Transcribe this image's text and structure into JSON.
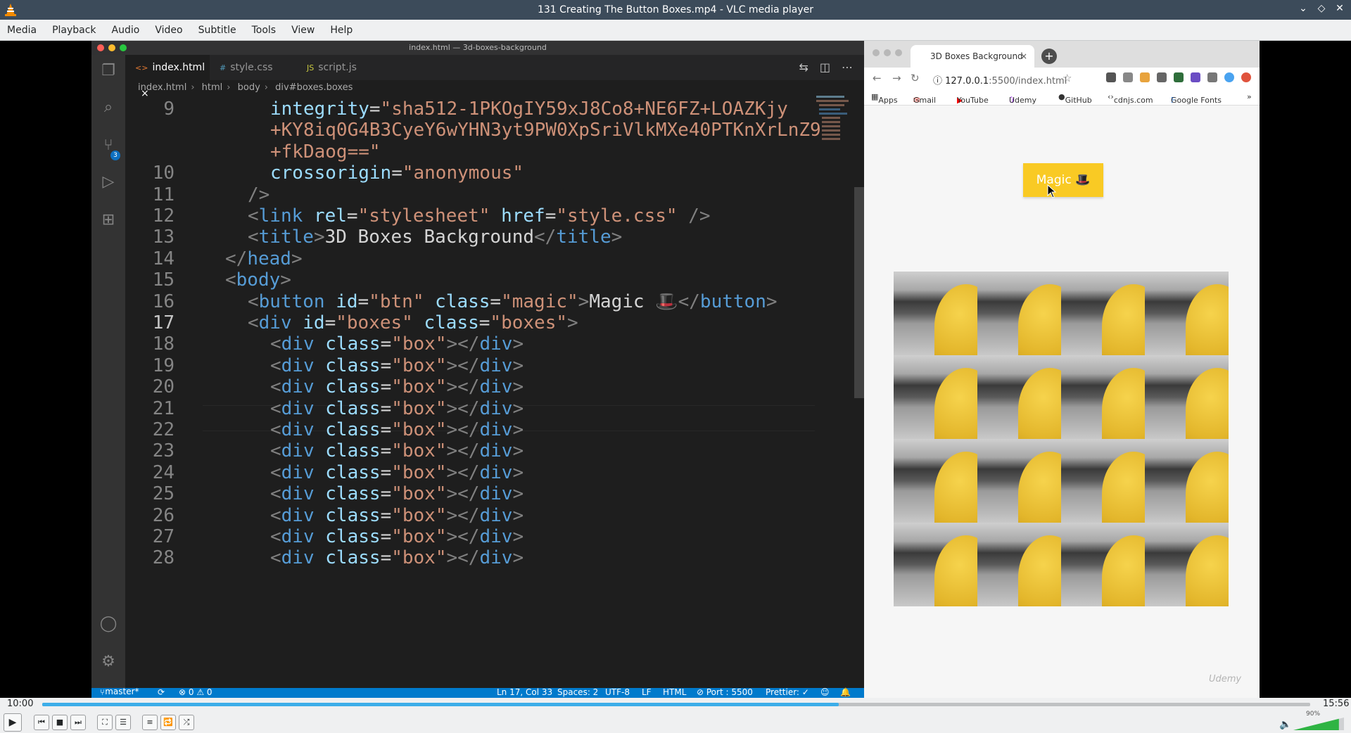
{
  "window": {
    "title": "131 Creating The Button Boxes.mp4 - VLC media player",
    "controls": [
      "⌄",
      "◇",
      "✕"
    ]
  },
  "menu": [
    "Media",
    "Playback",
    "Audio",
    "Video",
    "Subtitle",
    "Tools",
    "View",
    "Help"
  ],
  "editor": {
    "window_title": "index.html — 3d-boxes-background",
    "tabs": [
      {
        "icon": "<>",
        "label": "index.html",
        "close": "×"
      },
      {
        "icon": "#",
        "label": "style.css"
      },
      {
        "icon": "JS",
        "label": "script.js"
      }
    ],
    "breadcrumb": [
      "index.html",
      "html",
      "body",
      "div#boxes.boxes"
    ],
    "scm_badge": "3",
    "lines": [
      {
        "n": "9",
        "parts": [
          [
            "t-attr",
            "integrity"
          ],
          [
            "t-txt",
            "="
          ],
          [
            "t-str",
            "\"sha512-1PKOgIY59xJ8Co8+NE6FZ+LOAZKjy"
          ]
        ]
      },
      {
        "n": "",
        "parts": [
          [
            "t-str",
            "+KY8iq0G4B3CyeY6wYHN3yt9PW0XpSriVlkMXe40PTKnXrLnZ9"
          ]
        ]
      },
      {
        "n": "",
        "parts": [
          [
            "t-str",
            "+fkDaog==\""
          ]
        ]
      },
      {
        "n": "10",
        "parts": [
          [
            "t-attr",
            "crossorigin"
          ],
          [
            "t-txt",
            "="
          ],
          [
            "t-str",
            "\"anonymous\""
          ]
        ]
      },
      {
        "n": "11",
        "parts": [
          [
            "t-brk",
            "/>"
          ]
        ]
      },
      {
        "n": "12",
        "parts": [
          [
            "t-brk",
            "<"
          ],
          [
            "t-tag",
            "link"
          ],
          [
            "t-txt",
            " "
          ],
          [
            "t-attr",
            "rel"
          ],
          [
            "t-txt",
            "="
          ],
          [
            "t-str",
            "\"stylesheet\""
          ],
          [
            "t-txt",
            " "
          ],
          [
            "t-attr",
            "href"
          ],
          [
            "t-txt",
            "="
          ],
          [
            "t-str",
            "\"style.css\""
          ],
          [
            "t-txt",
            " "
          ],
          [
            "t-brk",
            "/>"
          ]
        ]
      },
      {
        "n": "13",
        "parts": [
          [
            "t-brk",
            "<"
          ],
          [
            "t-tag",
            "title"
          ],
          [
            "t-brk",
            ">"
          ],
          [
            "t-txt",
            "3D Boxes Background"
          ],
          [
            "t-brk",
            "</"
          ],
          [
            "t-tag",
            "title"
          ],
          [
            "t-brk",
            ">"
          ]
        ]
      },
      {
        "n": "14",
        "parts": [
          [
            "t-brk",
            "</"
          ],
          [
            "t-tag",
            "head"
          ],
          [
            "t-brk",
            ">"
          ]
        ]
      },
      {
        "n": "15",
        "parts": [
          [
            "t-brk",
            "<"
          ],
          [
            "t-tag",
            "body"
          ],
          [
            "t-brk",
            ">"
          ]
        ]
      },
      {
        "n": "16",
        "parts": [
          [
            "t-brk",
            "<"
          ],
          [
            "t-tag",
            "button"
          ],
          [
            "t-txt",
            " "
          ],
          [
            "t-attr",
            "id"
          ],
          [
            "t-txt",
            "="
          ],
          [
            "t-str",
            "\"btn\""
          ],
          [
            "t-txt",
            " "
          ],
          [
            "t-attr",
            "class"
          ],
          [
            "t-txt",
            "="
          ],
          [
            "t-str",
            "\"magic\""
          ],
          [
            "t-brk",
            ">"
          ],
          [
            "t-txt",
            "Magic 🎩"
          ],
          [
            "t-brk",
            "</"
          ],
          [
            "t-tag",
            "button"
          ],
          [
            "t-brk",
            ">"
          ]
        ]
      },
      {
        "n": "17",
        "parts": [
          [
            "t-brk",
            "<"
          ],
          [
            "t-tag",
            "div"
          ],
          [
            "t-txt",
            " "
          ],
          [
            "t-attr",
            "id"
          ],
          [
            "t-txt",
            "="
          ],
          [
            "t-str",
            "\"boxes\""
          ],
          [
            "t-txt",
            " "
          ],
          [
            "t-attr",
            "class"
          ],
          [
            "t-txt",
            "="
          ],
          [
            "t-str",
            "\"boxes\""
          ],
          [
            "t-brk",
            ">"
          ]
        ]
      },
      {
        "n": "18",
        "parts": [
          [
            "t-brk",
            "<"
          ],
          [
            "t-tag",
            "div"
          ],
          [
            "t-txt",
            " "
          ],
          [
            "t-attr",
            "class"
          ],
          [
            "t-txt",
            "="
          ],
          [
            "t-str",
            "\"box\""
          ],
          [
            "t-brk",
            "></"
          ],
          [
            "t-tag",
            "div"
          ],
          [
            "t-brk",
            ">"
          ]
        ]
      },
      {
        "n": "19",
        "parts": [
          [
            "t-brk",
            "<"
          ],
          [
            "t-tag",
            "div"
          ],
          [
            "t-txt",
            " "
          ],
          [
            "t-attr",
            "class"
          ],
          [
            "t-txt",
            "="
          ],
          [
            "t-str",
            "\"box\""
          ],
          [
            "t-brk",
            "></"
          ],
          [
            "t-tag",
            "div"
          ],
          [
            "t-brk",
            ">"
          ]
        ]
      },
      {
        "n": "20",
        "parts": [
          [
            "t-brk",
            "<"
          ],
          [
            "t-tag",
            "div"
          ],
          [
            "t-txt",
            " "
          ],
          [
            "t-attr",
            "class"
          ],
          [
            "t-txt",
            "="
          ],
          [
            "t-str",
            "\"box\""
          ],
          [
            "t-brk",
            "></"
          ],
          [
            "t-tag",
            "div"
          ],
          [
            "t-brk",
            ">"
          ]
        ]
      },
      {
        "n": "21",
        "parts": [
          [
            "t-brk",
            "<"
          ],
          [
            "t-tag",
            "div"
          ],
          [
            "t-txt",
            " "
          ],
          [
            "t-attr",
            "class"
          ],
          [
            "t-txt",
            "="
          ],
          [
            "t-str",
            "\"box\""
          ],
          [
            "t-brk",
            "></"
          ],
          [
            "t-tag",
            "div"
          ],
          [
            "t-brk",
            ">"
          ]
        ]
      },
      {
        "n": "22",
        "parts": [
          [
            "t-brk",
            "<"
          ],
          [
            "t-tag",
            "div"
          ],
          [
            "t-txt",
            " "
          ],
          [
            "t-attr",
            "class"
          ],
          [
            "t-txt",
            "="
          ],
          [
            "t-str",
            "\"box\""
          ],
          [
            "t-brk",
            "></"
          ],
          [
            "t-tag",
            "div"
          ],
          [
            "t-brk",
            ">"
          ]
        ]
      },
      {
        "n": "23",
        "parts": [
          [
            "t-brk",
            "<"
          ],
          [
            "t-tag",
            "div"
          ],
          [
            "t-txt",
            " "
          ],
          [
            "t-attr",
            "class"
          ],
          [
            "t-txt",
            "="
          ],
          [
            "t-str",
            "\"box\""
          ],
          [
            "t-brk",
            "></"
          ],
          [
            "t-tag",
            "div"
          ],
          [
            "t-brk",
            ">"
          ]
        ]
      },
      {
        "n": "24",
        "parts": [
          [
            "t-brk",
            "<"
          ],
          [
            "t-tag",
            "div"
          ],
          [
            "t-txt",
            " "
          ],
          [
            "t-attr",
            "class"
          ],
          [
            "t-txt",
            "="
          ],
          [
            "t-str",
            "\"box\""
          ],
          [
            "t-brk",
            "></"
          ],
          [
            "t-tag",
            "div"
          ],
          [
            "t-brk",
            ">"
          ]
        ]
      },
      {
        "n": "25",
        "parts": [
          [
            "t-brk",
            "<"
          ],
          [
            "t-tag",
            "div"
          ],
          [
            "t-txt",
            " "
          ],
          [
            "t-attr",
            "class"
          ],
          [
            "t-txt",
            "="
          ],
          [
            "t-str",
            "\"box\""
          ],
          [
            "t-brk",
            "></"
          ],
          [
            "t-tag",
            "div"
          ],
          [
            "t-brk",
            ">"
          ]
        ]
      },
      {
        "n": "26",
        "parts": [
          [
            "t-brk",
            "<"
          ],
          [
            "t-tag",
            "div"
          ],
          [
            "t-txt",
            " "
          ],
          [
            "t-attr",
            "class"
          ],
          [
            "t-txt",
            "="
          ],
          [
            "t-str",
            "\"box\""
          ],
          [
            "t-brk",
            "></"
          ],
          [
            "t-tag",
            "div"
          ],
          [
            "t-brk",
            ">"
          ]
        ]
      },
      {
        "n": "27",
        "parts": [
          [
            "t-brk",
            "<"
          ],
          [
            "t-tag",
            "div"
          ],
          [
            "t-txt",
            " "
          ],
          [
            "t-attr",
            "class"
          ],
          [
            "t-txt",
            "="
          ],
          [
            "t-str",
            "\"box\""
          ],
          [
            "t-brk",
            "></"
          ],
          [
            "t-tag",
            "div"
          ],
          [
            "t-brk",
            ">"
          ]
        ]
      },
      {
        "n": "28",
        "parts": [
          [
            "t-brk",
            "<"
          ],
          [
            "t-tag",
            "div"
          ],
          [
            "t-txt",
            " "
          ],
          [
            "t-attr",
            "class"
          ],
          [
            "t-txt",
            "="
          ],
          [
            "t-str",
            "\"box\""
          ],
          [
            "t-brk",
            "></"
          ],
          [
            "t-tag",
            "div"
          ],
          [
            "t-brk",
            ">"
          ]
        ]
      }
    ],
    "status": {
      "branch": "master*",
      "problems": "⊗ 0 ⚠ 0",
      "position": "Ln 17, Col 33",
      "spaces": "Spaces: 2",
      "encoding": "UTF-8",
      "eol": "LF",
      "language": "HTML",
      "port": "⊘ Port : 5500",
      "prettier": "Prettier: ✓"
    }
  },
  "browser": {
    "tab_title": "3D Boxes Background",
    "tab_close": "×",
    "new_tab": "+",
    "url_host": "127.0.0.1",
    "url_path": ":5500/index.html",
    "bookmarks": [
      "Apps",
      "Gmail",
      "YouTube",
      "Udemy",
      "GitHub",
      "cdnjs.com",
      "Google Fonts"
    ],
    "bookmarks_more": "»",
    "magic_button_label": "Magic 🎩",
    "watermark": "Udemy"
  },
  "player": {
    "elapsed": "10:00",
    "total": "15:56",
    "progress": 0.628,
    "volume_label": "90%",
    "volume": 0.9
  },
  "colors": {
    "vscode_status": "#007acc",
    "magic_button": "#f9ca24",
    "vlc_seek": "#3daee9"
  }
}
